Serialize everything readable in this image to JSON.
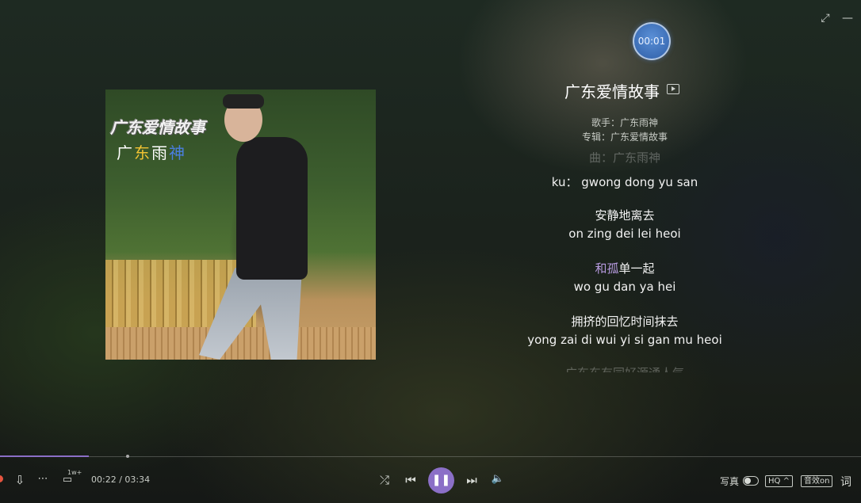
{
  "window": {
    "fullscreen_icon": "⤢",
    "minimize_icon": "—"
  },
  "timer": {
    "label": "00:01"
  },
  "cover": {
    "title_art": "广东爱情故事",
    "artist_art": [
      "广",
      "东",
      "雨",
      "神"
    ],
    "artist_colors": [
      "#ffffff",
      "#f0c232",
      "#ffffff",
      "#4a7fe0"
    ]
  },
  "song": {
    "title": "广东爱情故事",
    "singer_label": "歌手：",
    "singer": "广东雨神",
    "album_label": "专辑：",
    "album": "广东爱情故事"
  },
  "lyrics": {
    "faded_top": "曲：广东雨神",
    "lines": [
      {
        "zh": "",
        "en": "ku： gwong dong yu san"
      },
      {
        "zh": "安静地离去",
        "en": "on zing dei lei heoi"
      },
      {
        "zh_hl": "和孤",
        "zh_rest": "单一起",
        "en": "wo gu dan ya hei"
      },
      {
        "zh": "拥挤的回忆时间抹去",
        "en": "yong zai di wui yi si gan mu heoi"
      }
    ],
    "faded_bottom": "广东东有同好源通人气"
  },
  "playback": {
    "current_time": "00:22",
    "separator": " / ",
    "total_time": "03:34",
    "progress_fraction": 0.103,
    "comment_badge": "1w+"
  },
  "controls": {
    "shuffle_icon": "⤮",
    "prev_icon": "⏮",
    "pause_icon": "❚❚",
    "next_icon": "⏭",
    "volume_icon": "🔈"
  },
  "right_controls": {
    "photo_label": "写真",
    "quality_label": "HQ ^",
    "effect_label": "音效on",
    "lyric_label": "词"
  },
  "colors": {
    "accent": "#8b6fc7",
    "lyric_highlight": "#b79be0"
  }
}
